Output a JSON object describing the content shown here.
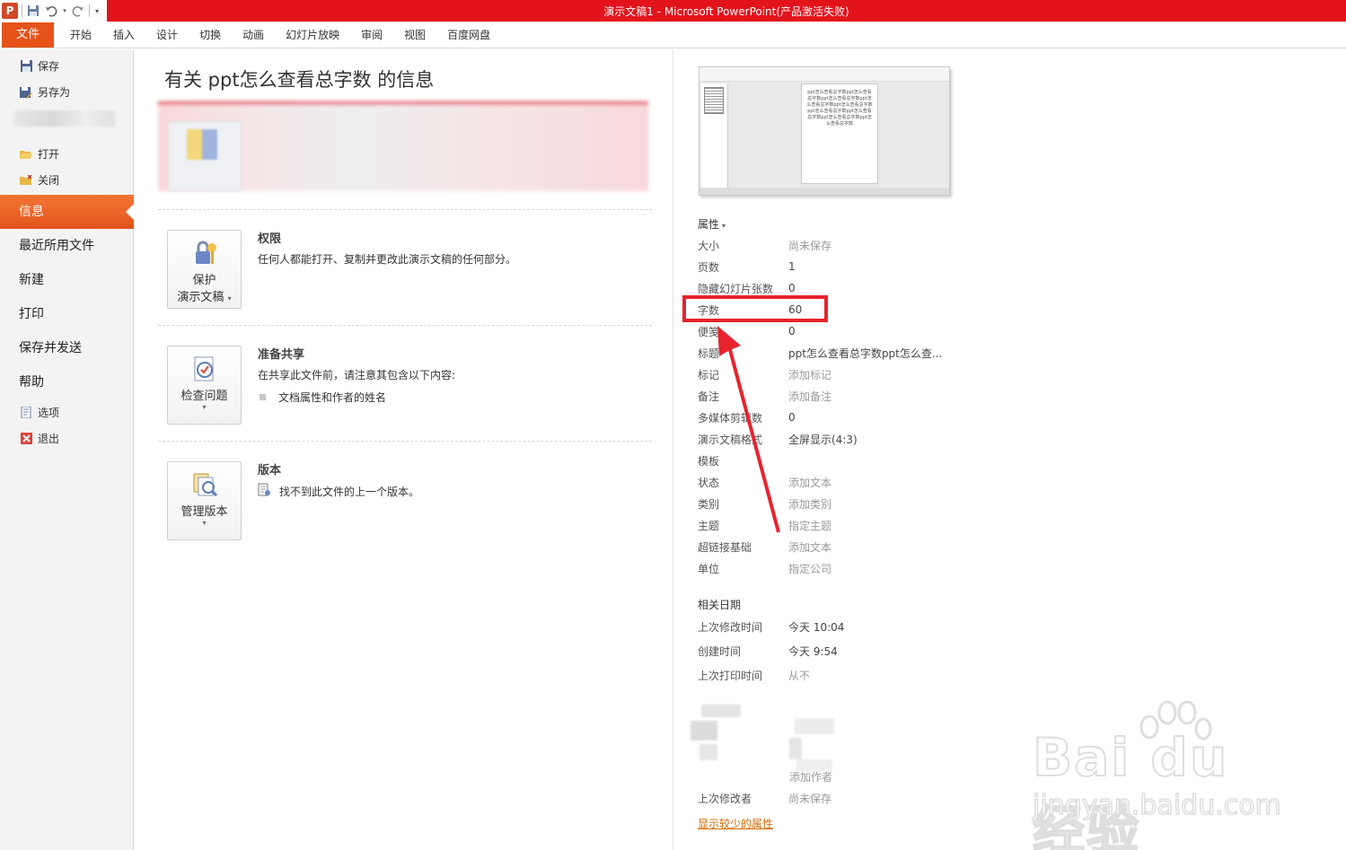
{
  "window": {
    "title": "演示文稿1 - Microsoft PowerPoint(产品激活失败)",
    "app_icon": "P"
  },
  "ribbon_tabs": [
    "文件",
    "开始",
    "插入",
    "设计",
    "切换",
    "动画",
    "幻灯片放映",
    "审阅",
    "视图",
    "百度网盘"
  ],
  "nav": {
    "save": "保存",
    "save_as": "另存为",
    "open": "打开",
    "close": "关闭",
    "info": "信息",
    "recent": "最近所用文件",
    "new": "新建",
    "print": "打印",
    "save_send": "保存并发送",
    "help": "帮助",
    "options": "选项",
    "exit": "退出"
  },
  "main": {
    "title": "有关 ppt怎么查看总字数 的信息",
    "permissions": {
      "button_line1": "保护",
      "button_line2": "演示文稿",
      "heading": "权限",
      "desc": "任何人都能打开、复制并更改此演示文稿的任何部分。"
    },
    "share": {
      "button": "检查问题",
      "heading": "准备共享",
      "desc": "在共享此文件前，请注意其包含以下内容:",
      "bullet": "文档属性和作者的姓名"
    },
    "versions": {
      "button": "管理版本",
      "heading": "版本",
      "desc": "找不到此文件的上一个版本。"
    }
  },
  "preview": {
    "slide_text": "ppt怎么查看总字数ppt怎么查看总字数ppt怎么查看总字数ppt怎么查看总字数ppt怎么查看总字数ppt怎么查看总字数ppt怎么查看总字数ppt怎么查看总字数ppt怎么查看总字数"
  },
  "properties": {
    "heading": "属性",
    "rows": [
      {
        "key": "大小",
        "value": "尚未保存",
        "placeholder": true
      },
      {
        "key": "页数",
        "value": "1",
        "placeholder": false
      },
      {
        "key": "隐藏幻灯片张数",
        "value": "0",
        "placeholder": false
      },
      {
        "key": "字数",
        "value": "60",
        "placeholder": false
      },
      {
        "key": "便笺",
        "value": "0",
        "placeholder": false
      },
      {
        "key": "标题",
        "value": "ppt怎么查看总字数ppt怎么查...",
        "placeholder": false
      },
      {
        "key": "标记",
        "value": "添加标记",
        "placeholder": true
      },
      {
        "key": "备注",
        "value": "添加备注",
        "placeholder": true
      },
      {
        "key": "多媒体剪辑数",
        "value": "0",
        "placeholder": false
      },
      {
        "key": "演示文稿格式",
        "value": "全屏显示(4:3)",
        "placeholder": false
      },
      {
        "key": "模板",
        "value": "",
        "placeholder": false
      },
      {
        "key": "状态",
        "value": "添加文本",
        "placeholder": true
      },
      {
        "key": "类别",
        "value": "添加类别",
        "placeholder": true
      },
      {
        "key": "主题",
        "value": "指定主题",
        "placeholder": true
      },
      {
        "key": "超链接基础",
        "value": "添加文本",
        "placeholder": true
      },
      {
        "key": "单位",
        "value": "指定公司",
        "placeholder": true
      }
    ]
  },
  "dates": {
    "heading": "相关日期",
    "rows": [
      {
        "key": "上次修改时间",
        "value": "今天 10:04",
        "placeholder": false
      },
      {
        "key": "创建时间",
        "value": "今天 9:54",
        "placeholder": false
      },
      {
        "key": "上次打印时间",
        "value": "从不",
        "placeholder": true
      }
    ]
  },
  "people": {
    "add_author": "添加作者",
    "last_modified_by_key": "上次修改者",
    "last_modified_by_value": "尚未保存",
    "show_less": "显示较少的属性"
  },
  "watermark": {
    "line1": "Bai du 经验",
    "line2": "jingyan.baidu.com"
  },
  "colors": {
    "accent": "#e5531b",
    "titlebar": "#e3131b",
    "highlight": "#e8232d",
    "link": "#d26b00"
  }
}
